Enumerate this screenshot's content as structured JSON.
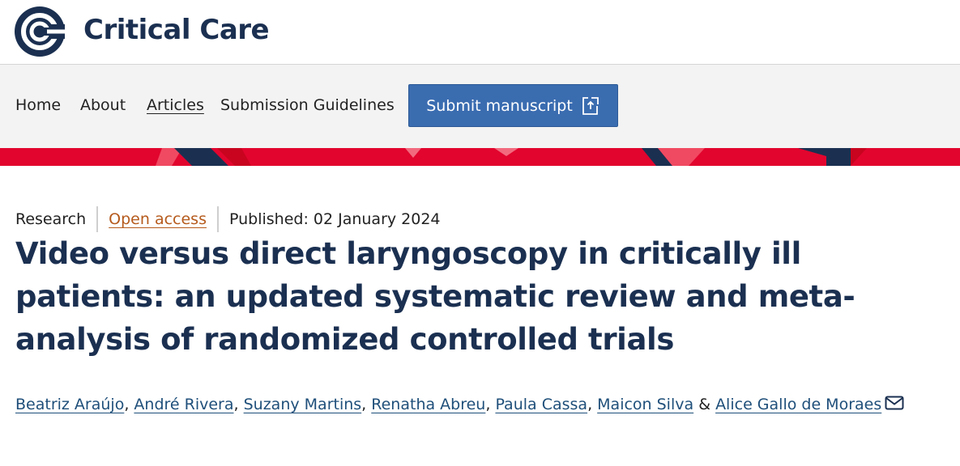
{
  "header": {
    "journal_name": "Critical Care"
  },
  "nav": {
    "items": [
      {
        "label": "Home"
      },
      {
        "label": "About"
      },
      {
        "label": "Articles"
      },
      {
        "label": "Submission Guidelines"
      }
    ],
    "active_item": "Articles",
    "submit_label": "Submit manuscript",
    "submit_icon": "external-link-icon"
  },
  "colors": {
    "brand_navy": "#1b3051",
    "button_blue": "#3a6cb0",
    "banner_red": "#e2052e",
    "open_access": "#b55a1c",
    "link_blue": "#1f4f7a"
  },
  "article": {
    "type": "Research",
    "access": "Open access",
    "published": "Published: 02 January 2024",
    "title_lines": [
      "Video versus direct laryngoscopy in critically ill",
      "patients: an updated systematic review and meta-",
      "analysis of randomized controlled trials"
    ],
    "authors": [
      "Beatriz Araújo",
      "André Rivera",
      "Suzany Martins",
      "Renatha Abreu",
      "Paula Cassa",
      "Maicon Silva",
      "Alice Gallo de Moraes"
    ],
    "author_separator": ",",
    "author_final_separator": "&",
    "corresponding_icon": "mail-icon"
  }
}
